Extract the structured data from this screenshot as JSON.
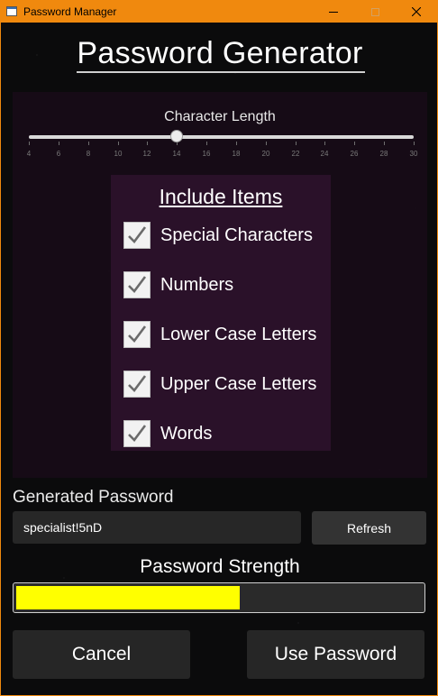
{
  "window": {
    "title": "Password Manager",
    "accent_color": "#f0890e",
    "controls": {
      "minimize_icon": "minimize-icon",
      "maximize_icon": "maximize-icon",
      "close_icon": "close-icon"
    }
  },
  "header": {
    "title": "Password Generator"
  },
  "length_slider": {
    "label": "Character Length",
    "min": 4,
    "max": 30,
    "value": 14,
    "ticks": [
      "4",
      "6",
      "8",
      "10",
      "12",
      "14",
      "16",
      "18",
      "20",
      "22",
      "24",
      "26",
      "28",
      "30"
    ]
  },
  "include": {
    "title": "Include Items",
    "options": [
      {
        "label": "Special Characters",
        "checked": true
      },
      {
        "label": "Numbers",
        "checked": true
      },
      {
        "label": "Lower Case Letters",
        "checked": true
      },
      {
        "label": "Upper Case Letters",
        "checked": true
      },
      {
        "label": "Words",
        "checked": true
      }
    ]
  },
  "generated": {
    "label": "Generated Password",
    "value": "specialist!5nD",
    "refresh_label": "Refresh"
  },
  "strength": {
    "label": "Password Strength",
    "level": 0.55,
    "color": "#ffff00"
  },
  "actions": {
    "cancel_label": "Cancel",
    "use_label": "Use Password"
  }
}
